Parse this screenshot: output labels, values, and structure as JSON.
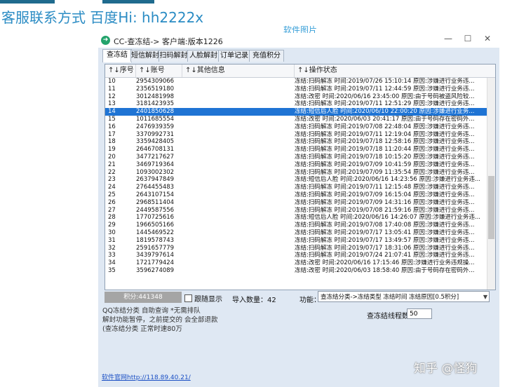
{
  "page": {
    "headline": "客服联系方式 百度Hi: hh2222x",
    "caption": "软件图片",
    "watermark": "知乎 @怪狗"
  },
  "window": {
    "title": "CC-查冻结-> 客户端:版本1226",
    "minimize_glyph": "—",
    "maximize_glyph": "☐",
    "close_glyph": "✕"
  },
  "tabs": [
    {
      "label": "查冻结",
      "active": true
    },
    {
      "label": "短信解封"
    },
    {
      "label": "扫码解封"
    },
    {
      "label": "人脸解封"
    },
    {
      "label": "订单记录"
    },
    {
      "label": "充值积分"
    }
  ],
  "columns": [
    "↑↓序号",
    "↑↓账号",
    "↑↓其他信息",
    "↑↓操作状态"
  ],
  "rows": [
    {
      "no": "10",
      "account": "2954309066",
      "info": "",
      "status": "冻结:扫码解冻 时间:2019/07/26 15:10:14 原因:涉嫌进行业务违..."
    },
    {
      "no": "11",
      "account": "2356519180",
      "info": "",
      "status": "冻结:扫码解冻 时间:2019/07/11 12:44:59 原因:涉嫌进行业务违..."
    },
    {
      "no": "12",
      "account": "3012481998",
      "info": "",
      "status": "冻结:改密 时间:2020/06/16 23:45:00 原因:由于号码被盗风险较..."
    },
    {
      "no": "13",
      "account": "3181423935",
      "info": "",
      "status": "冻结:扫码解冻 时间:2019/07/11 12:51:29 原因:涉嫌进行业务违..."
    },
    {
      "no": "14",
      "account": "2401850628",
      "info": "",
      "status": "冻结:短信后人脸 时间:2020/06/10 22:00:20 原因:涉嫌进行业务...",
      "selected": true
    },
    {
      "no": "15",
      "account": "1011685554",
      "info": "",
      "status": "冻结:改密 时间:2020/06/03 20:41:17 原因:由于号码存在密码外..."
    },
    {
      "no": "16",
      "account": "2476939359",
      "info": "",
      "status": "冻结:扫码解冻 时间:2019/07/08 22:48:04 原因:涉嫌进行业务违..."
    },
    {
      "no": "17",
      "account": "3370992731",
      "info": "",
      "status": "冻结:扫码解冻 时间:2019/07/11 12:19:04 原因:涉嫌进行业务违..."
    },
    {
      "no": "18",
      "account": "3359428405",
      "info": "",
      "status": "冻结:扫码解冻 时间:2019/07/18 12:58:16 原因:涉嫌进行业务违..."
    },
    {
      "no": "19",
      "account": "2646708131",
      "info": "",
      "status": "冻结:扫码解冻 时间:2019/07/18 11:20:44 原因:涉嫌进行业务违..."
    },
    {
      "no": "20",
      "account": "3477217627",
      "info": "",
      "status": "冻结:扫码解冻 时间:2019/07/18 10:15:20 原因:涉嫌进行业务违..."
    },
    {
      "no": "21",
      "account": "3469719364",
      "info": "",
      "status": "冻结:扫码解冻 时间:2019/07/09 10:41:59 原因:涉嫌进行业务违..."
    },
    {
      "no": "22",
      "account": "1093002302",
      "info": "",
      "status": "冻结:扫码解冻 时间:2019/07/09 11:35:54 原因:涉嫌进行业务违..."
    },
    {
      "no": "23",
      "account": "2637947849",
      "info": "",
      "status": "冻结:短信后人脸 时间:2020/06/16 14:23:56 原因:涉嫌进行业务违..."
    },
    {
      "no": "24",
      "account": "2764455483",
      "info": "",
      "status": "冻结:扫码解冻 时间:2019/07/11 12:15:48 原因:涉嫌进行业务违..."
    },
    {
      "no": "25",
      "account": "2643107154",
      "info": "",
      "status": "冻结:扫码解冻 时间:2019/07/09 16:15:04 原因:涉嫌进行业务违..."
    },
    {
      "no": "26",
      "account": "2968511404",
      "info": "",
      "status": "冻结:扫码解冻 时间:2019/07/09 14:31:16 原因:涉嫌进行业务违..."
    },
    {
      "no": "27",
      "account": "2449587556",
      "info": "",
      "status": "冻结:扫码解冻 时间:2019/07/08 21:59:16 原因:涉嫌进行业务违..."
    },
    {
      "no": "28",
      "account": "1770725616",
      "info": "",
      "status": "冻结:短信后人脸 时间:2020/06/16 14:26:07 原因:涉嫌进行业务违..."
    },
    {
      "no": "29",
      "account": "1966505166",
      "info": "",
      "status": "冻结:扫码解冻 时间:2019/07/08 17:40:08 原因:涉嫌进行业务违..."
    },
    {
      "no": "30",
      "account": "1445469522",
      "info": "",
      "status": "冻结:扫码解冻 时间:2019/07/17 13:05:41 原因:涉嫌进行业务违..."
    },
    {
      "no": "31",
      "account": "1819578743",
      "info": "",
      "status": "冻结:扫码解冻 时间:2019/07/17 13:49:57 原因:涉嫌进行业务违..."
    },
    {
      "no": "32",
      "account": "2591657779",
      "info": "",
      "status": "冻结:扫码解冻 时间:2019/07/17 18:31:06 原因:涉嫌进行业务违..."
    },
    {
      "no": "33",
      "account": "3439797614",
      "info": "",
      "status": "冻结:扫码解冻 时间:2019/07/24 21:07:41 原因:涉嫌进行业务违..."
    },
    {
      "no": "34",
      "account": "1721779424",
      "info": "",
      "status": "冻结:改密 时间:2020/06/16 17:15:46 原因:涉嫌进行业务违规操..."
    },
    {
      "no": "35",
      "account": "3596274089",
      "info": "",
      "status": "冻结:改密 时间:2020/06/03 18:58:40 原因:由于号码存在密码外..."
    }
  ],
  "controls": {
    "score_button": "积分:441348",
    "follow_label": "跟随显示",
    "import_label": "导入数量：",
    "import_count": "42",
    "function_label": "功能：",
    "function_value": "查冻结分类->冻结类型 冻结时间 冻结原因[0.5积分]",
    "freeze_threads_label": "查冻结线程数",
    "freeze_threads_value": "50"
  },
  "notes": [
    "QQ冻结分类 自助查询 *无需排队",
    "解封功能暂停，之前提交的 会全部退款",
    "(查冻结分类 正常时速80万"
  ],
  "footer_link": "软件官网http://118.89.40.21/",
  "colors": {
    "accent": "#2b8cc4",
    "selected_row": "#1f74d4",
    "window_bg": "#dfe8f3"
  }
}
